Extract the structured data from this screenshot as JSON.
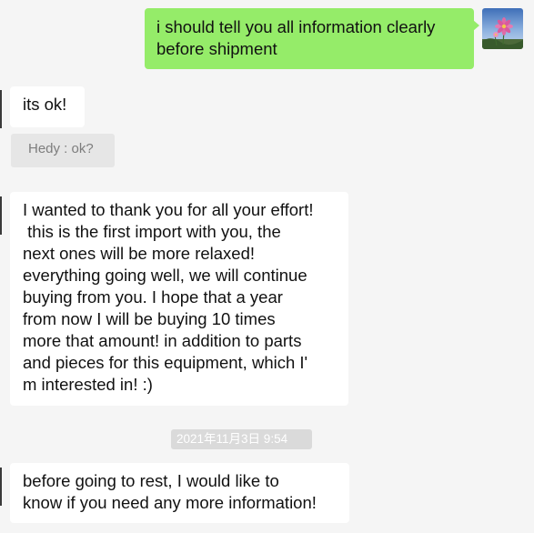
{
  "messages": [
    {
      "side": "out",
      "lines": [
        "i should tell you all information clearly",
        "before shipment"
      ]
    },
    {
      "side": "in",
      "lines": [
        "its ok!"
      ]
    },
    {
      "side": "quote",
      "text": "Hedy : ok?"
    },
    {
      "side": "in",
      "lines": [
        "I wanted to thank you for all your effort!",
        " this is the first import with you, the",
        "next ones will be more relaxed!",
        "everything going well, we will continue",
        "buying from you. I hope that a year",
        "from now I will be buying 10 times",
        "more that amount! in addition to parts",
        "and pieces for this equipment, which I'",
        "m interested in! :)"
      ]
    },
    {
      "side": "time",
      "text": "2021年11月3日 9:54"
    },
    {
      "side": "in",
      "lines": [
        "before going to rest, I would like to",
        "know if you need any more information!"
      ]
    }
  ],
  "colors": {
    "background": "#f5f5f5",
    "outgoing_bubble": "#95ec69",
    "incoming_bubble": "#ffffff",
    "quote_bg": "#e6e6e6",
    "timestamp_bg": "#dadada"
  },
  "icons": {
    "self_avatar": "flower-avatar-icon"
  }
}
